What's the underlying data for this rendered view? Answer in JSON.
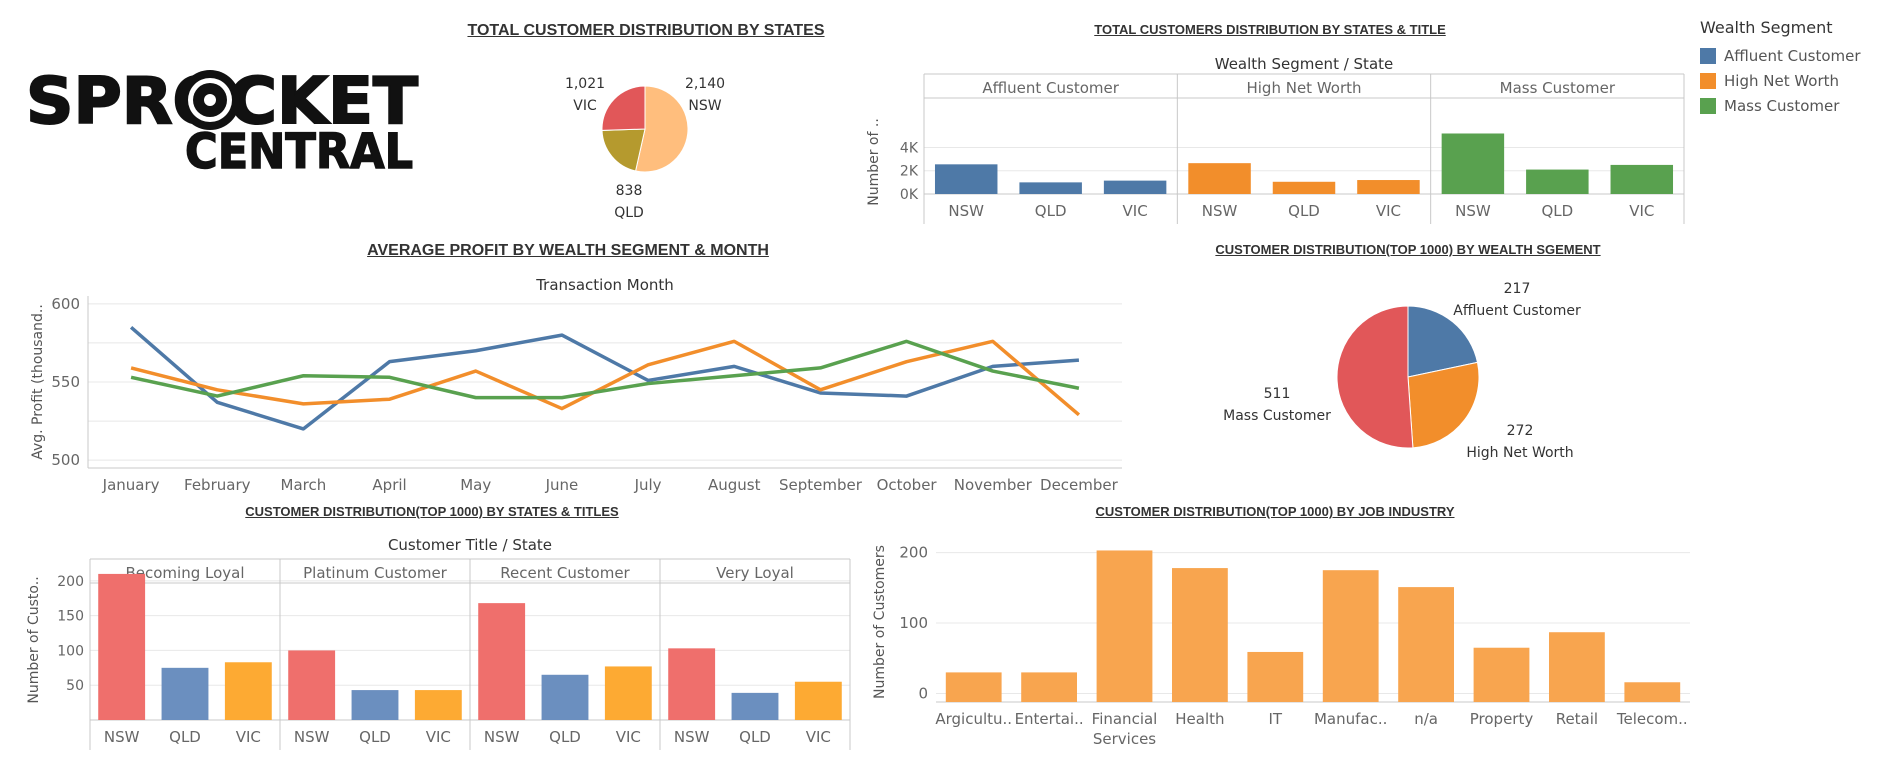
{
  "titles": {
    "states_pie": "TOTAL CUSTOMER DISTRIBUTION BY STATES",
    "states_title_bar": "TOTAL CUSTOMERS DISTRIBUTION BY STATES & TITLE",
    "avg_profit": "AVERAGE PROFIT BY WEALTH SEGMENT & MONTH",
    "wealth_pie": "CUSTOMER DISTRIBUTION(TOP 1000) BY WEALTH SGEMENT",
    "top_states_titles": "CUSTOMER DISTRIBUTION(TOP 1000) BY STATES & TITLES",
    "job_industry": "CUSTOMER DISTRIBUTION(TOP 1000) BY JOB INDUSTRY"
  },
  "logo": {
    "line1": "SPROCKET",
    "line2": "CENTRAL"
  },
  "legend": {
    "title": "Wealth Segment",
    "items": [
      {
        "label": "Affluent Customer",
        "color": "#4e79a7"
      },
      {
        "label": "High Net Worth",
        "color": "#f28e2b"
      },
      {
        "label": "Mass Customer",
        "color": "#59a14f"
      }
    ]
  },
  "chart_data": [
    {
      "id": "states_pie",
      "type": "pie",
      "slices": [
        {
          "label": "NSW",
          "value": 2140,
          "display": "2,140",
          "color": "#ffbe7d"
        },
        {
          "label": "QLD",
          "value": 838,
          "display": "838",
          "color": "#b59a2e"
        },
        {
          "label": "VIC",
          "value": 1021,
          "display": "1,021",
          "color": "#e15759"
        }
      ]
    },
    {
      "id": "states_title_bar",
      "type": "bar",
      "header": "Wealth Segment  /  State",
      "ylabel": "Number of ..",
      "ylim": [
        0,
        5500
      ],
      "yticks": [
        {
          "v": 0,
          "t": "0K"
        },
        {
          "v": 2000,
          "t": "2K"
        },
        {
          "v": 4000,
          "t": "4K"
        }
      ],
      "groups": [
        {
          "name": "Affluent Customer",
          "color": "#4e79a7",
          "categories": [
            "NSW",
            "QLD",
            "VIC"
          ],
          "values": [
            2550,
            1000,
            1150
          ]
        },
        {
          "name": "High Net Worth",
          "color": "#f28e2b",
          "categories": [
            "NSW",
            "QLD",
            "VIC"
          ],
          "values": [
            2650,
            1050,
            1200
          ]
        },
        {
          "name": "Mass Customer",
          "color": "#59a14f",
          "categories": [
            "NSW",
            "QLD",
            "VIC"
          ],
          "values": [
            5200,
            2100,
            2500
          ]
        }
      ]
    },
    {
      "id": "avg_profit",
      "type": "line",
      "header": "Transaction Month",
      "ylabel": "Avg. Profit (thousand..",
      "ylim": [
        495,
        605
      ],
      "yticks": [
        500,
        550,
        600
      ],
      "categories": [
        "January",
        "February",
        "March",
        "April",
        "May",
        "June",
        "July",
        "August",
        "September",
        "October",
        "November",
        "December"
      ],
      "series": [
        {
          "name": "Affluent Customer",
          "color": "#4e79a7",
          "values": [
            585,
            537,
            520,
            563,
            570,
            580,
            551,
            560,
            543,
            541,
            560,
            564
          ]
        },
        {
          "name": "High Net Worth",
          "color": "#f28e2b",
          "values": [
            559,
            545,
            536,
            539,
            557,
            533,
            561,
            576,
            545,
            563,
            576,
            529
          ]
        },
        {
          "name": "Mass Customer",
          "color": "#59a14f",
          "values": [
            553,
            541,
            554,
            553,
            540,
            540,
            549,
            554,
            559,
            576,
            557,
            546
          ]
        }
      ]
    },
    {
      "id": "wealth_pie",
      "type": "pie",
      "slices": [
        {
          "label": "Affluent Customer",
          "value": 217,
          "display": "217",
          "color": "#4e79a7"
        },
        {
          "label": "High Net Worth",
          "value": 272,
          "display": "272",
          "color": "#f28e2b"
        },
        {
          "label": "Mass Customer",
          "value": 511,
          "display": "511",
          "color": "#e15759"
        }
      ]
    },
    {
      "id": "top_states_titles",
      "type": "bar",
      "header": "Customer Title  /  State",
      "ylabel": "Number of Custo..",
      "ylim": [
        0,
        230
      ],
      "yticks": [
        {
          "v": 50,
          "t": "50"
        },
        {
          "v": 100,
          "t": "100"
        },
        {
          "v": 150,
          "t": "150"
        },
        {
          "v": 200,
          "t": "200"
        }
      ],
      "colors": {
        "NSW": "#ef6f6c",
        "QLD": "#6b8fbf",
        "VIC": "#fdaa33"
      },
      "groups": [
        {
          "name": "Becoming Loyal",
          "categories": [
            "NSW",
            "QLD",
            "VIC"
          ],
          "values": [
            210,
            75,
            83
          ]
        },
        {
          "name": "Platinum Customer",
          "categories": [
            "NSW",
            "QLD",
            "VIC"
          ],
          "values": [
            100,
            43,
            43
          ]
        },
        {
          "name": "Recent Customer",
          "categories": [
            "NSW",
            "QLD",
            "VIC"
          ],
          "values": [
            168,
            65,
            77
          ]
        },
        {
          "name": "Very Loyal",
          "categories": [
            "NSW",
            "QLD",
            "VIC"
          ],
          "values": [
            103,
            39,
            55
          ]
        }
      ]
    },
    {
      "id": "job_industry",
      "type": "bar",
      "ylabel": "Number of Customers",
      "ylim": [
        -12,
        215
      ],
      "yticks": [
        0,
        100,
        200
      ],
      "color": "#f8a54f",
      "categories": [
        "Argicultu..",
        "Entertai..",
        "Financial Services",
        "Health",
        "IT",
        "Manufac..",
        "n/a",
        "Property",
        "Retail",
        "Telecom.."
      ],
      "values": [
        30,
        30,
        203,
        178,
        59,
        175,
        151,
        65,
        87,
        16
      ]
    }
  ]
}
